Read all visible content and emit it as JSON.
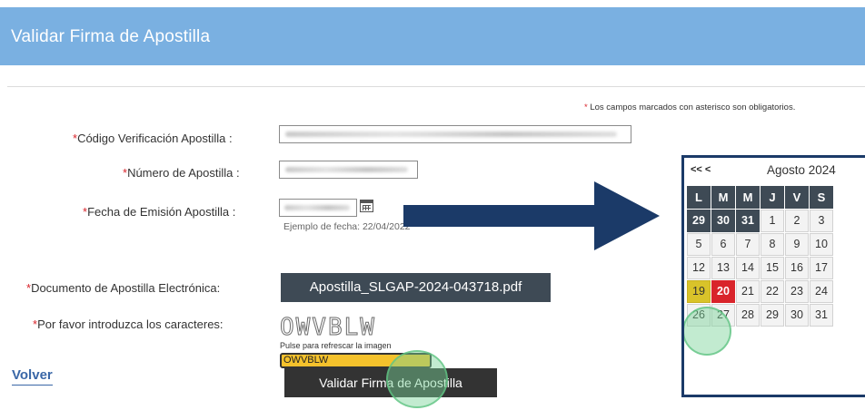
{
  "header": {
    "title": "Validar Firma de Apostilla"
  },
  "required_note": {
    "star": "*",
    "text": " Los campos marcados con asterisco son obligatorios."
  },
  "form": {
    "fields": [
      {
        "star": "*",
        "label": "Código Verificación Apostilla :"
      },
      {
        "star": "*",
        "label": "Número de Apostilla :"
      },
      {
        "star": "*",
        "label": "Fecha de Emisión Apostilla :"
      },
      {
        "star": "*",
        "label": "Documento de Apostilla Electrónica:"
      },
      {
        "star": "*",
        "label": "Por favor introduzca los caracteres:"
      }
    ],
    "date_hint": "Ejemplo de fecha: 22/04/2022",
    "file_name": "Apostilla_SLGAP-2024-043718.pdf",
    "captcha_image_text": "OWVBLW",
    "refresh_text": "Pulse para refrescar la imagen",
    "captcha_value": "OWVBLW"
  },
  "actions": {
    "back": "Volver",
    "submit": "Validar Firma de Apostilla"
  },
  "calendar": {
    "nav": "<< <",
    "title": "Agosto 2024",
    "weekdays": [
      "L",
      "M",
      "M",
      "J",
      "V",
      "S"
    ],
    "weeks": [
      [
        "29",
        "30",
        "31",
        "1",
        "2",
        "3"
      ],
      [
        "5",
        "6",
        "7",
        "8",
        "9",
        "10"
      ],
      [
        "12",
        "13",
        "14",
        "15",
        "16",
        "17"
      ],
      [
        "19",
        "20",
        "21",
        "22",
        "23",
        "24"
      ],
      [
        "26",
        "27",
        "28",
        "29",
        "30",
        "31"
      ]
    ],
    "selected_day": "19",
    "today_day": "20"
  },
  "colors": {
    "header_bg": "#7ab0e1",
    "required_star": "#d9242b",
    "dark_button": "#333333",
    "captcha_input_bg": "#f5c22c",
    "calendar_border": "#1b3a68",
    "calendar_today": "#d9242b",
    "calendar_selected": "#d9c32a",
    "arrow": "#1b3a68",
    "highlight_circle": "#78d296"
  }
}
